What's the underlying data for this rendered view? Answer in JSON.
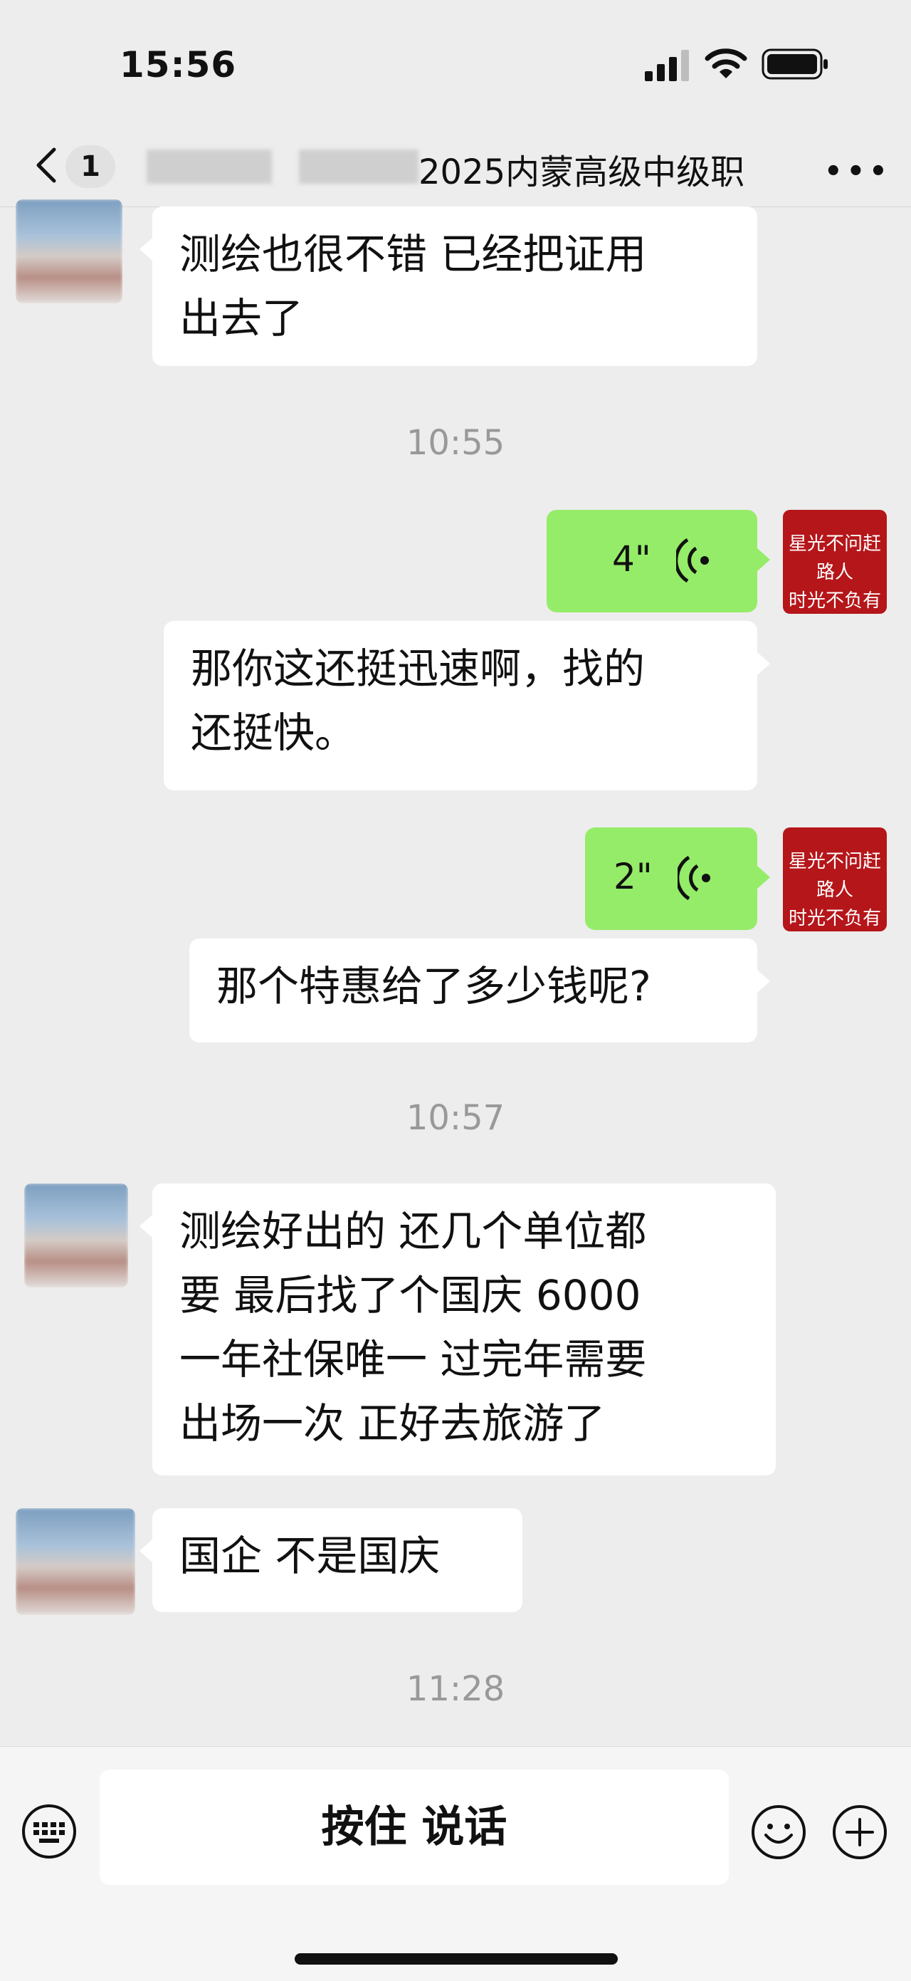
{
  "status_bar": {
    "time": "15:56"
  },
  "header": {
    "back_icon": "chevron-left-icon",
    "unread_count": "1",
    "title": "2025内蒙高级中级职",
    "more_icon": "more-dots-icon"
  },
  "messages": [
    {
      "type": "text",
      "side": "left",
      "text_lines": [
        "测绘也很不错 已经把证用",
        "出去了"
      ]
    },
    {
      "type": "timestamp",
      "text": "10:55"
    },
    {
      "type": "voice",
      "side": "right",
      "duration": "4\"",
      "icon": "voice-wave-icon"
    },
    {
      "type": "text",
      "side": "right",
      "text_lines": [
        "那你这还挺迅速啊，找的",
        "还挺快。"
      ]
    },
    {
      "type": "voice",
      "side": "right",
      "duration": "2\"",
      "icon": "voice-wave-icon"
    },
    {
      "type": "text",
      "side": "right",
      "text_lines": [
        "那个特惠给了多少钱呢?"
      ]
    },
    {
      "type": "timestamp",
      "text": "10:57"
    },
    {
      "type": "text",
      "side": "left",
      "text_lines": [
        "测绘好出的 还几个单位都",
        "要 最后找了个国庆 6000",
        "一年社保唯一 过完年需要",
        "出场一次 正好去旅游了"
      ]
    },
    {
      "type": "text",
      "side": "left",
      "text_lines": [
        "国企 不是国庆"
      ]
    },
    {
      "type": "timestamp",
      "text": "11:28"
    }
  ],
  "my_avatar_text": [
    "星光不问赶路人",
    "时光不负有心人"
  ],
  "input_bar": {
    "keyboard_icon": "keyboard-icon",
    "hold_to_talk_label": "按住 说话",
    "emoji_icon": "emoji-icon",
    "plus_icon": "plus-circle-icon"
  },
  "colors": {
    "background": "#ededed",
    "my_bubble": "#95ec69",
    "other_bubble": "#ffffff",
    "avatar_red": "#b5161a"
  }
}
